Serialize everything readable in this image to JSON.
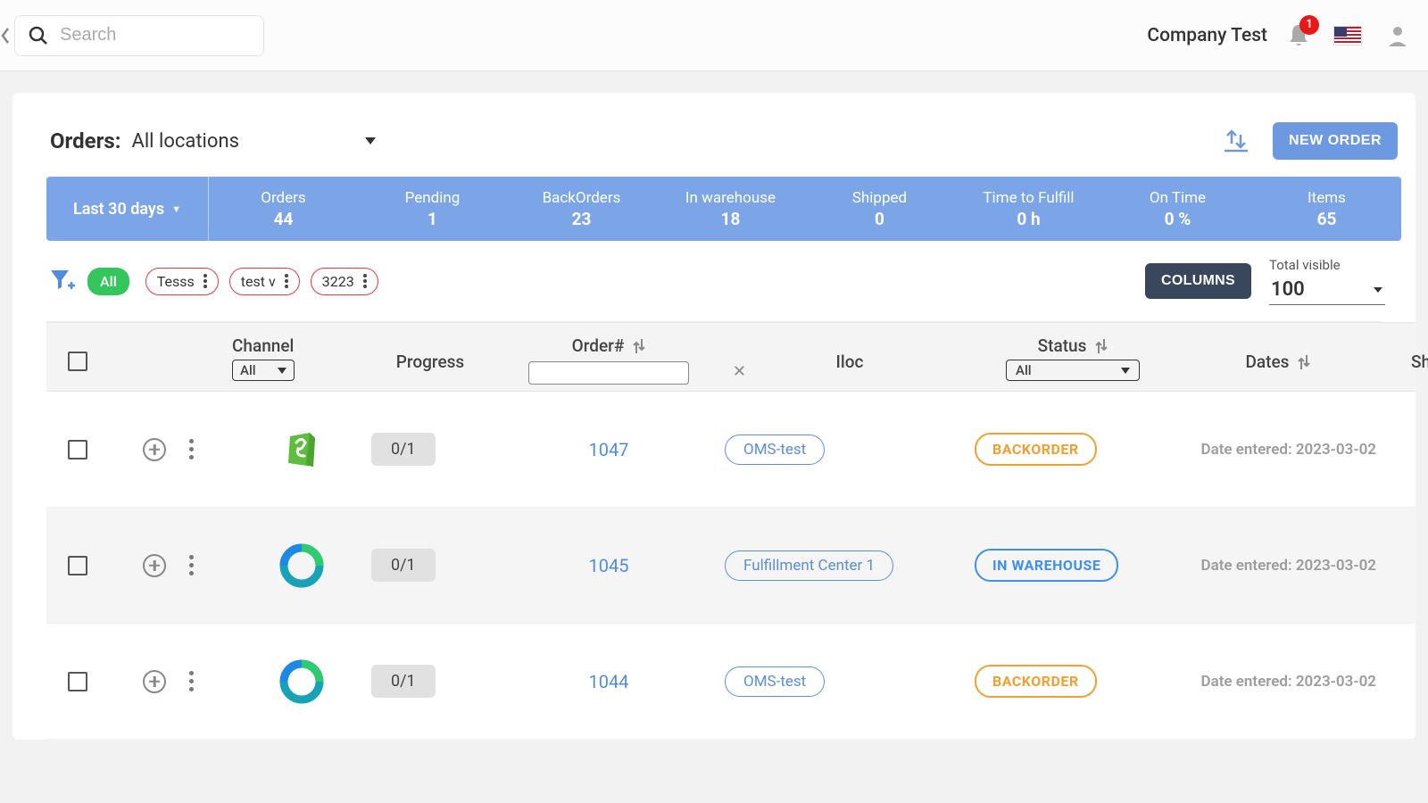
{
  "header": {
    "search_placeholder": "Search",
    "company": "Company Test",
    "notif_count": "1"
  },
  "title": {
    "label": "Orders:",
    "location": "All locations",
    "new_order_btn": "NEW ORDER"
  },
  "stats_period": "Last 30 days",
  "stats": [
    {
      "label": "Orders",
      "value": "44"
    },
    {
      "label": "Pending",
      "value": "1"
    },
    {
      "label": "BackOrders",
      "value": "23"
    },
    {
      "label": "In warehouse",
      "value": "18"
    },
    {
      "label": "Shipped",
      "value": "0"
    },
    {
      "label": "Time to Fulfill",
      "value": "0 h"
    },
    {
      "label": "On Time",
      "value": "0 %"
    },
    {
      "label": "Items",
      "value": "65"
    }
  ],
  "filters": {
    "all_chip": "All",
    "custom": [
      "Tesss",
      "test v",
      "3223"
    ],
    "columns_btn": "COLUMNS",
    "total_visible_label": "Total visible",
    "total_visible_value": "100"
  },
  "table": {
    "head": {
      "channel": "Channel",
      "channel_sel": "All",
      "progress": "Progress",
      "order": "Order#",
      "iloc": "Iloc",
      "status": "Status",
      "status_sel": "All",
      "dates": "Dates",
      "ship": "Sh"
    },
    "rows": [
      {
        "channel": "shopify",
        "progress": "0/1",
        "order": "1047",
        "iloc": "OMS-test",
        "status": "BACKORDER",
        "status_kind": "backorder",
        "date_label": "Date entered: 2023-03-02"
      },
      {
        "channel": "circle",
        "progress": "0/1",
        "order": "1045",
        "iloc": "Fulfillment Center 1",
        "status": "IN WAREHOUSE",
        "status_kind": "inwarehouse",
        "date_label": "Date entered: 2023-03-02"
      },
      {
        "channel": "circle",
        "progress": "0/1",
        "order": "1044",
        "iloc": "OMS-test",
        "status": "BACKORDER",
        "status_kind": "backorder",
        "date_label": "Date entered: 2023-03-02"
      }
    ]
  }
}
